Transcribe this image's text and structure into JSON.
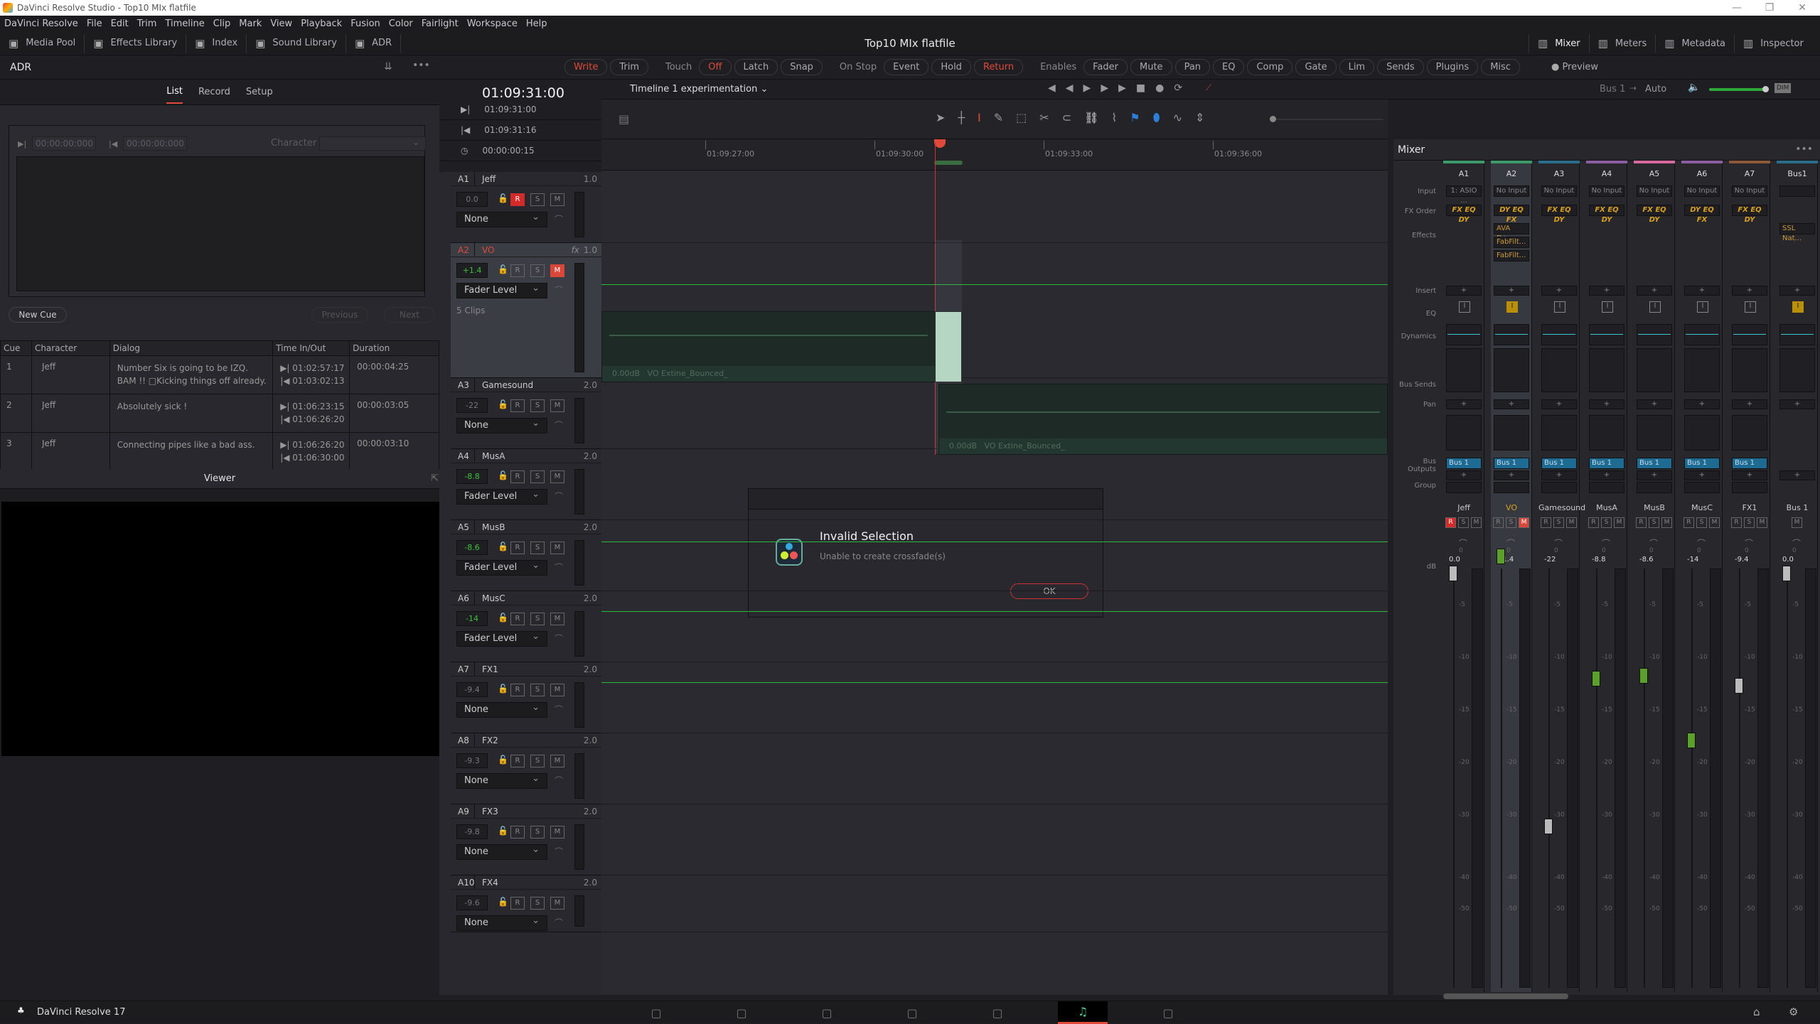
{
  "window": {
    "title": "DaVinci Resolve Studio - Top10 MIx flatfile",
    "controls": [
      "minimize-icon",
      "restore-icon",
      "close-icon"
    ]
  },
  "menu": [
    "DaVinci Resolve",
    "File",
    "Edit",
    "Trim",
    "Timeline",
    "Clip",
    "Mark",
    "View",
    "Playback",
    "Fusion",
    "Color",
    "Fairlight",
    "Workspace",
    "Help"
  ],
  "toolbar": {
    "left": [
      {
        "label": "Media Pool",
        "icon": "media-pool-icon"
      },
      {
        "label": "Effects Library",
        "icon": "effects-library-icon"
      },
      {
        "label": "Index",
        "icon": "index-icon"
      },
      {
        "label": "Sound Library",
        "icon": "sound-library-icon"
      },
      {
        "label": "ADR",
        "icon": "microphone-icon"
      }
    ],
    "project_title": "Top10 MIx flatfile",
    "right": [
      {
        "label": "Mixer",
        "icon": "mixer-icon"
      },
      {
        "label": "Meters",
        "icon": "meters-icon"
      },
      {
        "label": "Metadata",
        "icon": "metadata-icon"
      },
      {
        "label": "Inspector",
        "icon": "inspector-icon"
      }
    ]
  },
  "automation": {
    "write": "Write",
    "trim": "Trim",
    "touch_label": "Touch",
    "off": "Off",
    "latch": "Latch",
    "snap": "Snap",
    "onstop_label": "On Stop",
    "event": "Event",
    "hold": "Hold",
    "return": "Return",
    "enables_label": "Enables",
    "enables": [
      "Fader",
      "Mute",
      "Pan",
      "EQ",
      "Comp",
      "Gate",
      "Lim",
      "Sends",
      "Plugins",
      "Misc"
    ],
    "preview": "Preview"
  },
  "transport": {
    "timecode": "01:09:31:00",
    "timeline_name": "Timeline 1 experimentation",
    "bus": "Bus 1",
    "auto": "Auto",
    "dim": "DIM"
  },
  "adr": {
    "title": "ADR",
    "tabs": [
      "List",
      "Record",
      "Setup"
    ],
    "active_tab": "List",
    "in_tc": "00:00:00:000",
    "out_tc": "00:00:00:000",
    "character_label": "Character",
    "new_cue": "New Cue",
    "previous": "Previous",
    "next": "Next",
    "columns": [
      "Cue",
      "Character",
      "Dialog",
      "Time In/Out",
      "Duration"
    ],
    "cues": [
      {
        "cue": "1",
        "character": "Jeff",
        "dialog": "Number Six is going to be IZQ. BAM !! □Kicking things off already.",
        "in": "01:02:57:17",
        "out": "01:03:02:13",
        "duration": "00:00:04:25"
      },
      {
        "cue": "2",
        "character": "Jeff",
        "dialog": "Absolutely sick !",
        "in": "01:06:23:15",
        "out": "01:06:26:20",
        "duration": "00:00:03:05"
      },
      {
        "cue": "3",
        "character": "Jeff",
        "dialog": "Connecting pipes like a bad ass.",
        "in": "01:06:26:20",
        "out": "01:06:30:00",
        "duration": "00:00:03:10"
      }
    ]
  },
  "viewer": {
    "title": "Viewer"
  },
  "timecodes": {
    "in": "01:09:31:00",
    "out": "01:09:31:16",
    "duration": "00:00:00:15"
  },
  "tracks": [
    {
      "id": "A1",
      "name": "Jeff",
      "ch": "1.0",
      "vol": "0.0",
      "auto": "None",
      "r": true,
      "m": false,
      "vol_green": false
    },
    {
      "id": "A2",
      "name": "VO",
      "ch": "1.0",
      "vol": "+1.4",
      "auto": "Fader Level",
      "r": false,
      "m": true,
      "vol_green": true,
      "fx": "fx",
      "clips": "5 Clips"
    },
    {
      "id": "A3",
      "name": "Gamesound",
      "ch": "2.0",
      "vol": "-22",
      "auto": "None",
      "r": false,
      "m": false,
      "vol_green": false
    },
    {
      "id": "A4",
      "name": "MusA",
      "ch": "2.0",
      "vol": "-8.8",
      "auto": "Fader Level",
      "r": false,
      "m": false,
      "vol_green": true
    },
    {
      "id": "A5",
      "name": "MusB",
      "ch": "2.0",
      "vol": "-8.6",
      "auto": "Fader Level",
      "r": false,
      "m": false,
      "vol_green": true
    },
    {
      "id": "A6",
      "name": "MusC",
      "ch": "2.0",
      "vol": "-14",
      "auto": "Fader Level",
      "r": false,
      "m": false,
      "vol_green": true
    },
    {
      "id": "A7",
      "name": "FX1",
      "ch": "2.0",
      "vol": "-9.4",
      "auto": "None",
      "r": false,
      "m": false,
      "vol_green": false
    },
    {
      "id": "A8",
      "name": "FX2",
      "ch": "2.0",
      "vol": "-9.3",
      "auto": "None",
      "r": false,
      "m": false,
      "vol_green": false
    },
    {
      "id": "A9",
      "name": "FX3",
      "ch": "2.0",
      "vol": "-9.8",
      "auto": "None",
      "r": false,
      "m": false,
      "vol_green": false
    },
    {
      "id": "A10",
      "name": "FX4",
      "ch": "2.0",
      "vol": "-9.6",
      "auto": "None",
      "r": false,
      "m": false,
      "vol_green": false
    }
  ],
  "ruler": [
    "01:09:27:00",
    "01:09:30:00",
    "01:09:33:00",
    "01:09:36:00"
  ],
  "clips": [
    {
      "gain": "0.00dB",
      "name": "VO Extine_Bounced_"
    },
    {
      "gain": "0.00dB",
      "name": "VO Extine_Bounced_"
    }
  ],
  "dialog": {
    "title": "Invalid Selection",
    "message": "Unable to create crossfade(s)",
    "ok": "OK"
  },
  "mixer": {
    "title": "Mixer",
    "row_labels": [
      "Input",
      "FX Order",
      "Effects",
      "Insert",
      "EQ",
      "Dynamics",
      "Bus Sends",
      "Pan",
      "Bus Outputs",
      "Group",
      "dB"
    ],
    "channels": [
      {
        "id": "A1",
        "name": "Jeff",
        "input": "1: ASIO ...",
        "fxorder": "FX EQ DY",
        "effects": [],
        "insert_on": false,
        "bus": "Bus 1",
        "db": "0.0",
        "fader_db": 0.0,
        "color": "#3d9a6a",
        "r": true,
        "m": false
      },
      {
        "id": "A2",
        "name": "VO",
        "input": "No Input",
        "fxorder": "DY EQ FX",
        "effects": [
          "AVA De...",
          "FabFilt...",
          "FabFilt..."
        ],
        "insert_on": true,
        "bus": "Bus 1",
        "db": "+1.4",
        "fader_db": 1.4,
        "color": "#3d9a6a",
        "r": false,
        "m": true
      },
      {
        "id": "A3",
        "name": "Gamesound",
        "input": "No Input",
        "fxorder": "FX EQ DY",
        "effects": [],
        "insert_on": false,
        "bus": "Bus 1",
        "db": "-22",
        "fader_db": -22,
        "color": "#2a6d8c",
        "r": false,
        "m": false
      },
      {
        "id": "A4",
        "name": "MusA",
        "input": "No Input",
        "fxorder": "FX EQ DY",
        "effects": [],
        "insert_on": false,
        "bus": "Bus 1",
        "db": "-8.8",
        "fader_db": -8.8,
        "color": "#8a5ea0",
        "r": false,
        "m": false
      },
      {
        "id": "A5",
        "name": "MusB",
        "input": "No Input",
        "fxorder": "FX EQ DY",
        "effects": [],
        "insert_on": false,
        "bus": "Bus 1",
        "db": "-8.6",
        "fader_db": -8.6,
        "color": "#d86aa0",
        "r": false,
        "m": false
      },
      {
        "id": "A6",
        "name": "MusC",
        "input": "No Input",
        "fxorder": "DY EQ FX",
        "effects": [],
        "insert_on": false,
        "bus": "Bus 1",
        "db": "-14",
        "fader_db": -14,
        "color": "#8a5ea0",
        "r": false,
        "m": false
      },
      {
        "id": "A7",
        "name": "FX1",
        "input": "No Input",
        "fxorder": "FX EQ DY",
        "effects": [],
        "insert_on": false,
        "bus": "Bus 1",
        "db": "-9.4",
        "fader_db": -9.4,
        "color": "#8c5a3a",
        "r": false,
        "m": false
      },
      {
        "id": "Bus1",
        "name": "Bus 1",
        "input": "",
        "fxorder": "",
        "effects": [
          "SSL Nat..."
        ],
        "insert_on": true,
        "bus": "",
        "db": "0.0",
        "fader_db": 0.0,
        "color": "#2a6d8c",
        "r": false,
        "m": false
      }
    ],
    "scale": [
      "0",
      "-5",
      "-10",
      "-15",
      "-20",
      "-30",
      "-40",
      "-50"
    ]
  },
  "bottom": {
    "app": "DaVinci Resolve 17",
    "pages": [
      "media",
      "cut",
      "edit",
      "fusion",
      "color",
      "fairlight",
      "deliver"
    ],
    "active_page": "fairlight"
  }
}
